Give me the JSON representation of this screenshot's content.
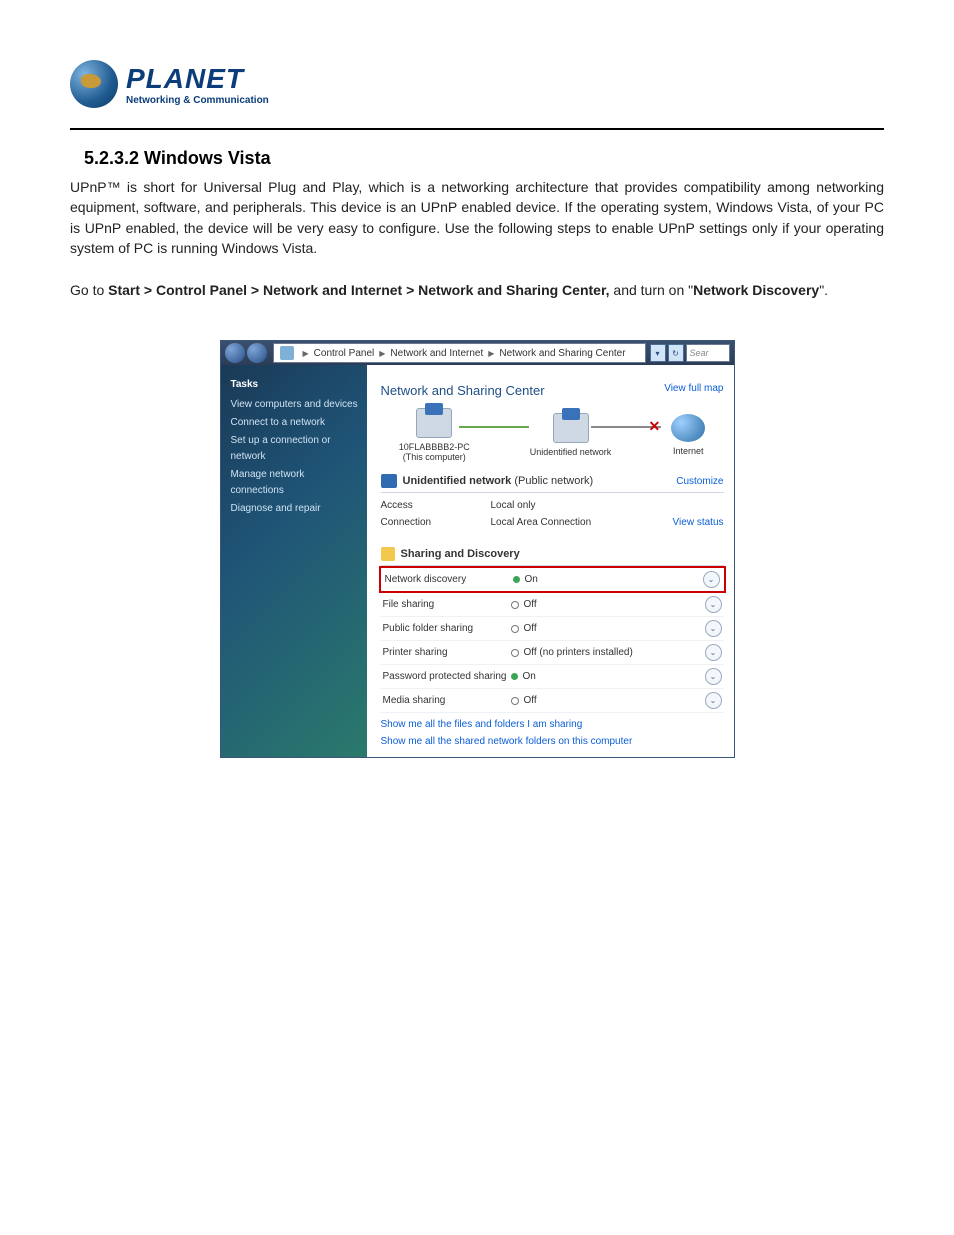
{
  "logo": {
    "brand": "PLANET",
    "sub": "Networking & Communication"
  },
  "heading": "5.2.3.2 Windows Vista",
  "para1_pre": "UPnP™ is short for Universal Plug and Play, which is a networking architecture that provides compatibility among networking equipment, software, and peripherals. This device is an UPnP enabled device. If the operating system, Windows Vista, of your PC is UPnP enabled, the device will be very easy to configure. Use the following steps to enable UPnP settings only if your operating system of PC is running Windows Vista.",
  "para2_a": "Go to ",
  "para2_b": "Start > Control Panel > Network and Internet > Network and Sharing Center,",
  "para2_c": " and turn on \"",
  "para2_d": "Network Discovery",
  "para2_e": "\".",
  "address": {
    "seg1": "Control Panel",
    "seg2": "Network and Internet",
    "seg3": "Network and Sharing Center",
    "search": "Sear"
  },
  "tasks": {
    "hd": "Tasks",
    "items": [
      "View computers and devices",
      "Connect to a network",
      "Set up a connection or network",
      "Manage network connections",
      "Diagnose and repair"
    ]
  },
  "main": {
    "title": "Network and Sharing Center",
    "view_full_map": "View full map",
    "node_pc_line1": "10FLABBBB2-PC",
    "node_pc_line2": "(This computer)",
    "node_net": "Unidentified network",
    "node_internet": "Internet",
    "net_header_bold": "Unidentified network",
    "net_header_paren": " (Public network)",
    "customize": "Customize",
    "access_k": "Access",
    "access_v": "Local only",
    "conn_k": "Connection",
    "conn_v": "Local Area Connection",
    "view_status": "View status",
    "sharing_hdr": "Sharing and Discovery",
    "rows": [
      {
        "k": "Network discovery",
        "on": true,
        "v": "On",
        "hl": true
      },
      {
        "k": "File sharing",
        "on": false,
        "v": "Off",
        "hl": false
      },
      {
        "k": "Public folder sharing",
        "on": false,
        "v": "Off",
        "hl": false
      },
      {
        "k": "Printer sharing",
        "on": false,
        "v": "Off (no printers installed)",
        "hl": false
      },
      {
        "k": "Password protected sharing",
        "on": true,
        "v": "On",
        "hl": false
      },
      {
        "k": "Media sharing",
        "on": false,
        "v": "Off",
        "hl": false
      }
    ],
    "link1": "Show me all the files and folders I am sharing",
    "link2": "Show me all the shared network folders on this computer"
  }
}
